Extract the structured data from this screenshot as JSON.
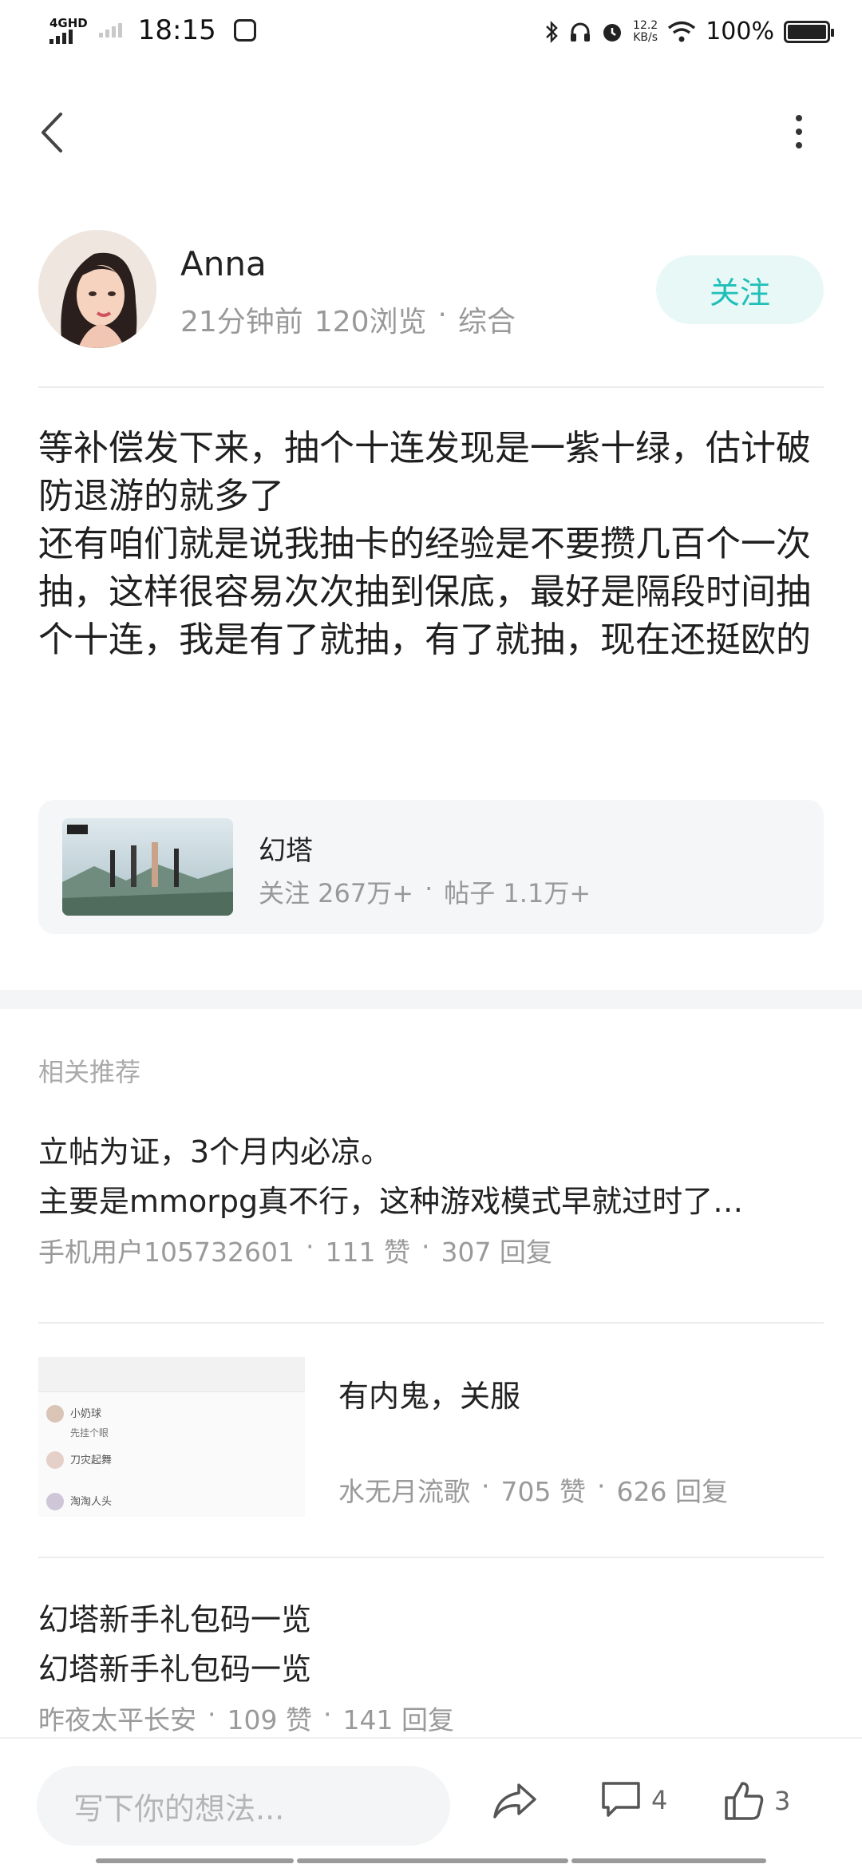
{
  "status_bar": {
    "network_label": "4GHD",
    "time": "18:15",
    "speed_value": "12.2",
    "speed_unit": "KB/s",
    "battery": "100%"
  },
  "post": {
    "author": "Anna",
    "time_ago": "21分钟前",
    "views": "120浏览",
    "separator": "·",
    "category": "综合",
    "follow_label": "关注",
    "content_lines": [
      "等补偿发下来，抽个十连发现是一紫十绿，估计破防退游的就多了",
      "还有咱们就是说我抽卡的经验是不要攒几百个一次抽，这样很容易次次抽到保底，最好是隔段时间抽个十连，我是有了就抽，有了就抽，现在还挺欧的"
    ],
    "forum": {
      "name": "幻塔",
      "followers": "关注 267万+",
      "posts": "帖子 1.1万+",
      "separator": "·"
    }
  },
  "recommendations": {
    "title": "相关推荐",
    "items": [
      {
        "line1": "立帖为证，3个月内必凉。",
        "line2": "主要是mmorpg真不行，这种游戏模式早就过时了…",
        "author": "手机用户105732601",
        "likes": "111 赞",
        "replies": "307 回复"
      },
      {
        "line1": "有内鬼，关服",
        "author": "水无月流歌",
        "likes": "705 赞",
        "replies": "626 回复",
        "thumb_users": [
          "小奶球",
          "刀灾起舞",
          "淘淘人头"
        ],
        "thumb_comment": "先挂个眼"
      },
      {
        "line1": "幻塔新手礼包码一览",
        "line2": "幻塔新手礼包码一览",
        "author": "昨夜太平长安",
        "likes": "109 赞",
        "replies": "141 回复"
      }
    ]
  },
  "bottom_bar": {
    "input_placeholder": "写下你的想法...",
    "comment_count": "4",
    "like_count": "3"
  },
  "colors": {
    "accent": "#1fbfb8",
    "accent_bg": "#e8f8f7",
    "muted_text": "#999999"
  }
}
